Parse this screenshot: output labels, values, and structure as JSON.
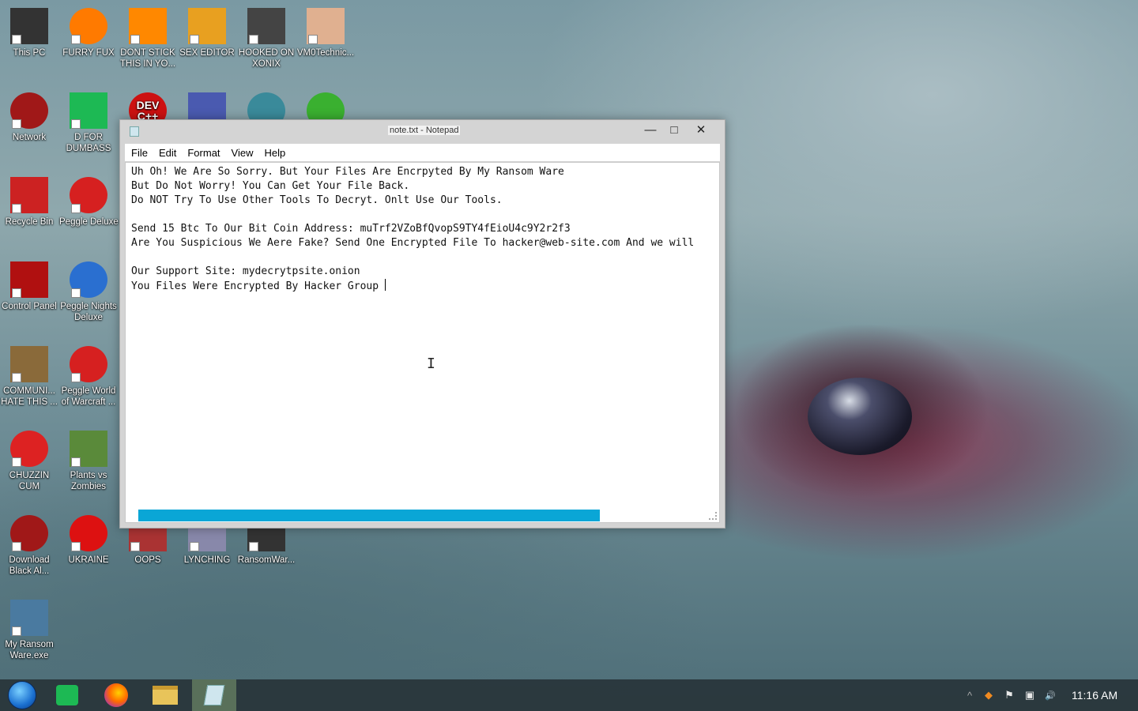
{
  "desktop": {
    "icons": [
      {
        "label": "This PC",
        "glyph": "monitor-icon",
        "color": "#333333"
      },
      {
        "label": "FURRY FUX",
        "glyph": "firefox-icon",
        "color": "#ff7a00"
      },
      {
        "label": "DONT STICK\nTHIS IN YO...",
        "glyph": "vlc-cone-icon",
        "color": "#ff8800"
      },
      {
        "label": "SEX EDITOR",
        "glyph": "hxd-icon",
        "color": "#e8a020"
      },
      {
        "label": "HOOKED ON\nXONIX",
        "glyph": "xonix-icon",
        "color": "#444444"
      },
      {
        "label": "VM0Technic...",
        "glyph": "doctor-icon",
        "color": "#e0b090"
      },
      {
        "label": "Network",
        "glyph": "network-orb-icon",
        "color": "#a01818"
      },
      {
        "label": "D FOR\nDUMBASS",
        "glyph": "notes-icon",
        "color": "#1db954"
      },
      {
        "label": "Recycle Bin",
        "glyph": "recycle-bin-icon",
        "color": "#cc2222"
      },
      {
        "label": "Peggle Deluxe",
        "glyph": "peggle-icon",
        "color": "#d62020"
      },
      {
        "label": "Control Panel",
        "glyph": "control-panel-icon",
        "color": "#b01010"
      },
      {
        "label": "Peggle Nights\nDeluxe",
        "glyph": "peggle-nights-icon",
        "color": "#2a6fd0"
      },
      {
        "label": "COMMUNI...\nHATE THIS ...",
        "glyph": "money-bag-icon",
        "color": "#8a6a3a"
      },
      {
        "label": "Peggle World\nof Warcraft ...",
        "glyph": "peggle-wow-icon",
        "color": "#d62020"
      },
      {
        "label": "CHUZZIN\nCUM",
        "glyph": "chuzzle-icon",
        "color": "#dd2222"
      },
      {
        "label": "Plants vs\nZombies",
        "glyph": "pvz-icon",
        "color": "#5a8a3a"
      },
      {
        "label": "Download\nBlack Al...",
        "glyph": "black-orb-icon",
        "color": "#a01818"
      },
      {
        "label": "UKRAINE",
        "glyph": "radiation-icon",
        "color": "#dd1111"
      },
      {
        "label": "OOPS",
        "glyph": "oops-icon",
        "color": "#aa3333"
      },
      {
        "label": "LYNCHING",
        "glyph": "lynching-icon",
        "color": "#8888aa"
      },
      {
        "label": "RansomWar...",
        "glyph": "skull-icon",
        "color": "#333333"
      },
      {
        "label": "My Ransom\nWare.exe",
        "glyph": "app-window-icon",
        "color": "#4a7aa0"
      },
      {
        "label": "DEV\nC++",
        "glyph": "devcpp-icon",
        "color": "#cc1111"
      },
      {
        "label": "",
        "glyph": "web-app-icon",
        "color": "#4a5ab0"
      },
      {
        "label": "",
        "glyph": "gamepad-globe-icon",
        "color": "#3a8a9a"
      },
      {
        "label": "",
        "glyph": "lime-icon",
        "color": "#3ab030"
      }
    ]
  },
  "window": {
    "title": "note.txt - Notepad",
    "minimize": "—",
    "maximize": "□",
    "close": "✕",
    "menu": [
      "File",
      "Edit",
      "Format",
      "View",
      "Help"
    ],
    "lines": [
      "Uh Oh! We Are So Sorry. But Your Files Are Encrpyted By My Ransom Ware",
      "But Do Not Worry! You Can Get Your File Back.",
      "Do NOT Try To Use Other Tools To Decryt. Onlt Use Our Tools.",
      "",
      "Send 15 Btc To Our Bit Coin Address: muTrf2VZoBfQvopS9TY4fEioU4c9Y2r2f3",
      "Are You Suspicious We Aere Fake? Send One Encrypted File To hacker@web-site.com And we will",
      "",
      "Our Support Site: mydecrytpsite.onion",
      "You Files Were Encrypted By Hacker Group "
    ]
  },
  "taskbar": {
    "items": [
      "start-orb-icon",
      "notes-app-icon",
      "firefox-icon",
      "file-explorer-icon",
      "notepad-icon"
    ],
    "tray": [
      "^",
      "◆",
      "⚑",
      "▣",
      "🔊"
    ],
    "clock": "11:16 AM"
  },
  "colors": {
    "accent": "#0aa6d6",
    "taskbar": "#28343a"
  }
}
